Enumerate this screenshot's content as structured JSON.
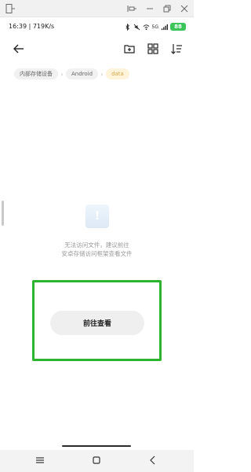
{
  "status_bar": {
    "time_speed": "16:39 | 719K/s",
    "network_label": "5G",
    "battery": "88"
  },
  "toolbar": {
    "back_icon": "back-arrow-icon",
    "new_folder_icon": "new-folder-icon",
    "grid_icon": "grid-view-icon",
    "sort_icon": "sort-icon"
  },
  "breadcrumb": {
    "items": [
      "内部存储设备",
      "Android",
      "data"
    ]
  },
  "empty_state": {
    "line1": "无法访问文件，建议前往",
    "line2": "安卓存储访问框架查看文件",
    "button_label": "前往查看"
  },
  "colors": {
    "highlight": "#2db32d",
    "active_crumb_bg": "#fff3d9",
    "active_crumb_text": "#d4a84e",
    "battery": "#3ac45a"
  },
  "nav_bar": {
    "menu_icon": "menu-icon",
    "home_icon": "home-square-icon",
    "back_icon": "back-chevron-icon"
  }
}
